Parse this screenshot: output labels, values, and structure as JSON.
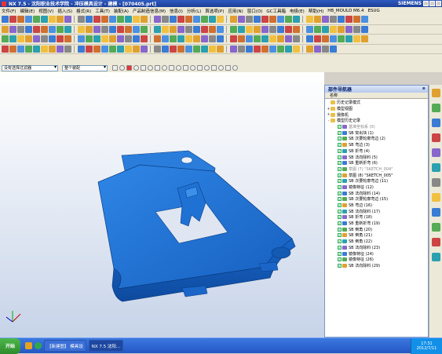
{
  "window": {
    "title": "NX 7.5 - 沈阳职业技术学院 - 冲压模具设计 - 建模 - [070405.prt]",
    "brand": "SIEMENS"
  },
  "menu": [
    "文件(F)",
    "编辑(E)",
    "视图(V)",
    "插入(S)",
    "格式(R)",
    "工具(T)",
    "装配(A)",
    "产品制造信息(M)",
    "信息(I)",
    "分析(L)",
    "首选项(P)",
    "应用(N)",
    "窗口(O)",
    "GC工具箱",
    "电极(E)",
    "帮助(H)",
    "HB_MOULD M6.4",
    "ESUG"
  ],
  "selection": {
    "filter": "没有选择过滤器",
    "scope": "整个装配"
  },
  "navigator": {
    "title": "部件导航器",
    "column": "名称",
    "items": [
      {
        "label": "历史记录模式",
        "level": 0,
        "expand": ""
      },
      {
        "label": "模型视图",
        "level": 0,
        "expand": "+"
      },
      {
        "label": "摄像机",
        "level": 0,
        "expand": "+"
      },
      {
        "label": "模型历史记录",
        "level": 0,
        "expand": "-"
      },
      {
        "label": "基准坐标系 (0)",
        "level": 1,
        "dim": true
      },
      {
        "label": "SB 突出块 (1)",
        "level": 1
      },
      {
        "label": "SB 次要轮廓弯边 (2)",
        "level": 1
      },
      {
        "label": "SB 弯边 (3)",
        "level": 1
      },
      {
        "label": "SB 折弯 (4)",
        "level": 1
      },
      {
        "label": "SB 法向除料 (5)",
        "level": 1
      },
      {
        "label": "SB 重新折弯 (6)",
        "level": 1
      },
      {
        "label": "草图 (7) \"SKETCH_004\"",
        "level": 1,
        "dim": true
      },
      {
        "label": "草图 (8) \"SKETCH_005\"",
        "level": 1
      },
      {
        "label": "SB 次要轮廓弯边 (11)",
        "level": 1
      },
      {
        "label": "镜像特征 (12)",
        "level": 1
      },
      {
        "label": "SB 法向除料 (14)",
        "level": 1
      },
      {
        "label": "SB 次要轮廓弯边 (15)",
        "level": 1
      },
      {
        "label": "SB 弯边 (16)",
        "level": 1
      },
      {
        "label": "SB 法向除料 (17)",
        "level": 1
      },
      {
        "label": "SB 折弯 (18)",
        "level": 1
      },
      {
        "label": "SB 重新折弯 (19)",
        "level": 1
      },
      {
        "label": "SB 倒角 (20)",
        "level": 1
      },
      {
        "label": "SB 倒角 (21)",
        "level": 1
      },
      {
        "label": "SB 倒角 (22)",
        "level": 1
      },
      {
        "label": "SB 法向除料 (23)",
        "level": 1
      },
      {
        "label": "镜像特征 (24)",
        "level": 1
      },
      {
        "label": "镜像特征 (26)",
        "level": 1
      },
      {
        "label": "SB 法向除料 (29)",
        "level": 1
      }
    ]
  },
  "taskbar": {
    "start": "开始",
    "items": [
      "【新建图】 模具设",
      "NX 7.5 沈阳..."
    ],
    "time": "17:31",
    "date": "2012/7/11"
  },
  "colors": {
    "part": "#1e6fd0",
    "accent": "#2456c4"
  }
}
